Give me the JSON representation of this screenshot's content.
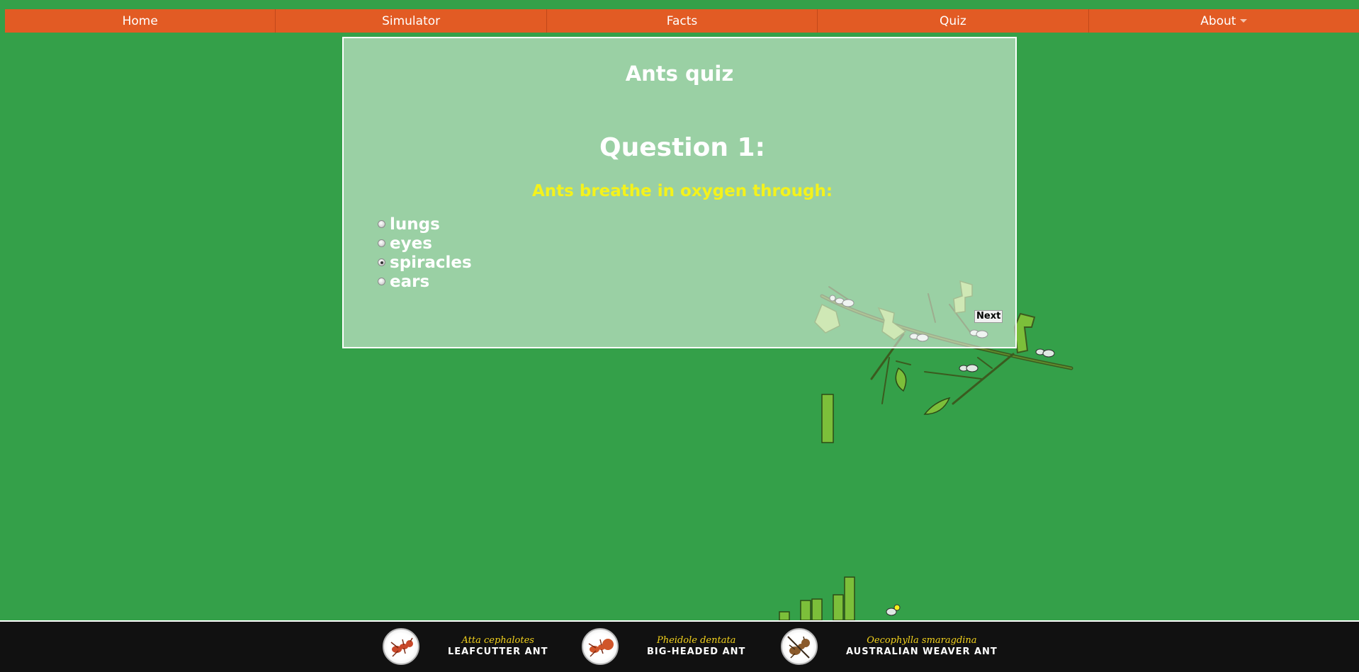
{
  "nav": {
    "items": [
      {
        "label": "Home"
      },
      {
        "label": "Simulator"
      },
      {
        "label": "Facts"
      },
      {
        "label": "Quiz"
      },
      {
        "label": "About",
        "icon": "chevron-down-icon"
      }
    ]
  },
  "quiz": {
    "title": "Ants quiz",
    "question_heading": "Question 1:",
    "question_text": "Ants breathe in oxygen through:",
    "options": [
      {
        "label": "lungs",
        "selected": false
      },
      {
        "label": "eyes",
        "selected": false
      },
      {
        "label": "spiracles",
        "selected": true
      },
      {
        "label": "ears",
        "selected": false
      }
    ],
    "next_label": "Next"
  },
  "footer": {
    "species": [
      {
        "latin": "Atta cephalotes",
        "common": "LEAFCUTTER ANT",
        "icon": "leafcutter-ant-icon"
      },
      {
        "latin": "Pheidole dentata",
        "common": "BIG-HEADED ANT",
        "icon": "big-headed-ant-icon"
      },
      {
        "latin": "Oecophylla smaragdina",
        "common": "AUSTRALIAN WEAVER ANT",
        "icon": "weaver-ant-icon"
      }
    ]
  },
  "colors": {
    "background": "#34a049",
    "nav": "#e25b24",
    "question_text": "#f4f21c",
    "footer": "#111111",
    "latin_name": "#f3d21c"
  }
}
